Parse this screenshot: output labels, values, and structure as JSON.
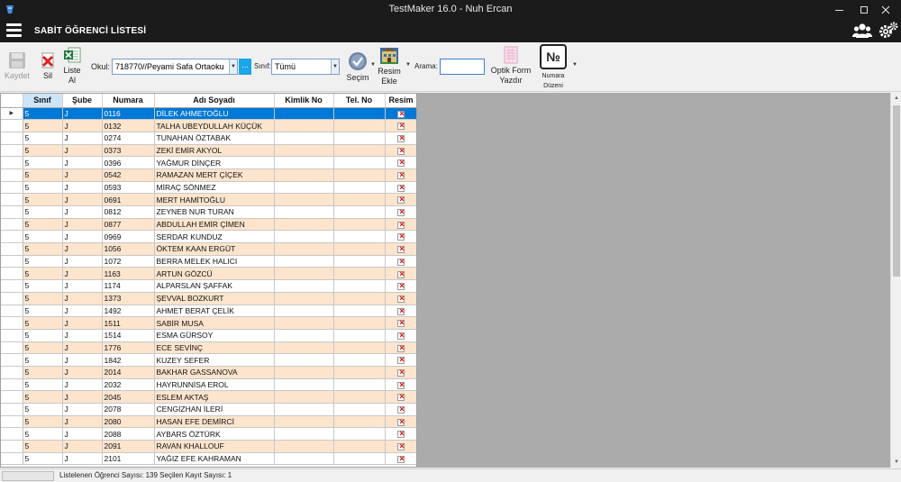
{
  "window": {
    "title": "TestMaker 16.0  -  Nuh Ercan"
  },
  "header": {
    "page_title": "SABİT ÖĞRENCİ LİSTESİ"
  },
  "toolbar": {
    "save_label": "Kaydet",
    "delete_label": "Sil",
    "list_label_1": "Liste",
    "list_label_2": "Al",
    "school_label": "Okul:",
    "school_value": "718770//Peyami Safa Ortaoku",
    "dots_label": "...",
    "class_label": "Sınıf:",
    "class_value": "Tümü",
    "select_label": "Seçim",
    "image_label_1": "Resim",
    "image_label_2": "Ekle",
    "search_label": "Arama:",
    "search_value": "",
    "optic_label_1": "Optik Form",
    "optic_label_2": "Yazdır",
    "number_symbol": "№",
    "number_label_1": "Numara",
    "number_label_2": "Düzeni"
  },
  "grid": {
    "columns": [
      "Sınıf",
      "Şube",
      "Numara",
      "Adı Soyadı",
      "Kimlik No",
      "Tel. No",
      "Resim"
    ],
    "selected_column": "Sınıf",
    "selected_row": 0,
    "rows": [
      [
        "5",
        "J",
        "0116",
        "DİLEK AHMETOĞLU"
      ],
      [
        "5",
        "J",
        "0132",
        "TALHA UBEYDULLAH KÜÇÜK"
      ],
      [
        "5",
        "J",
        "0274",
        "TUNAHAN ÖZTABAK"
      ],
      [
        "5",
        "J",
        "0373",
        "ZEKİ EMİR AKYOL"
      ],
      [
        "5",
        "J",
        "0396",
        "YAĞMUR DİNÇER"
      ],
      [
        "5",
        "J",
        "0542",
        "RAMAZAN MERT ÇİÇEK"
      ],
      [
        "5",
        "J",
        "0593",
        "MİRAÇ SÖNMEZ"
      ],
      [
        "5",
        "J",
        "0691",
        "MERT HAMİTOĞLU"
      ],
      [
        "5",
        "J",
        "0812",
        "ZEYNEB NUR TURAN"
      ],
      [
        "5",
        "J",
        "0877",
        "ABDULLAH EMİR ÇİMEN"
      ],
      [
        "5",
        "J",
        "0969",
        "SERDAR KUNDUZ"
      ],
      [
        "5",
        "J",
        "1056",
        "ÖKTEM KAAN ERGÜT"
      ],
      [
        "5",
        "J",
        "1072",
        "BERRA MELEK HALICI"
      ],
      [
        "5",
        "J",
        "1163",
        "ARTUN GÖZCÜ"
      ],
      [
        "5",
        "J",
        "1174",
        "ALPARSLAN ŞAFFAK"
      ],
      [
        "5",
        "J",
        "1373",
        "ŞEVVAL BOZKURT"
      ],
      [
        "5",
        "J",
        "1492",
        "AHMET BERAT ÇELİK"
      ],
      [
        "5",
        "J",
        "1511",
        "SABİR MUSA"
      ],
      [
        "5",
        "J",
        "1514",
        "ESMA GÜRSOY"
      ],
      [
        "5",
        "J",
        "1776",
        "ECE SEVİNÇ"
      ],
      [
        "5",
        "J",
        "1842",
        "KUZEY SEFER"
      ],
      [
        "5",
        "J",
        "2014",
        "BAKHAR GASSANOVA"
      ],
      [
        "5",
        "J",
        "2032",
        "HAYRUNNİSA EROL"
      ],
      [
        "5",
        "J",
        "2045",
        "ESLEM AKTAŞ"
      ],
      [
        "5",
        "J",
        "2078",
        "CENGİZHAN İLERİ"
      ],
      [
        "5",
        "J",
        "2080",
        "HASAN EFE DEMİRCİ"
      ],
      [
        "5",
        "J",
        "2088",
        "AYBARS ÖZTÜRK"
      ],
      [
        "5",
        "J",
        "2091",
        "RAVAN KHALLOUF"
      ],
      [
        "5",
        "J",
        "2101",
        "YAĞIZ EFE KAHRAMAN"
      ]
    ]
  },
  "status": {
    "text": "Listelenen Öğrenci Sayısı: 139 Seçilen Kayıt Sayısı: 1"
  },
  "icons": {
    "app": "testmaker-icon",
    "menu": "hamburger-icon",
    "users": "users-icon",
    "settings": "gears-icon",
    "row_image": "broken-image-icon"
  },
  "colors": {
    "titlebar": "#1b1b1b",
    "selected_row": "#0078d7",
    "alt_row": "#fde4cc",
    "accent_button": "#18a7e8"
  }
}
